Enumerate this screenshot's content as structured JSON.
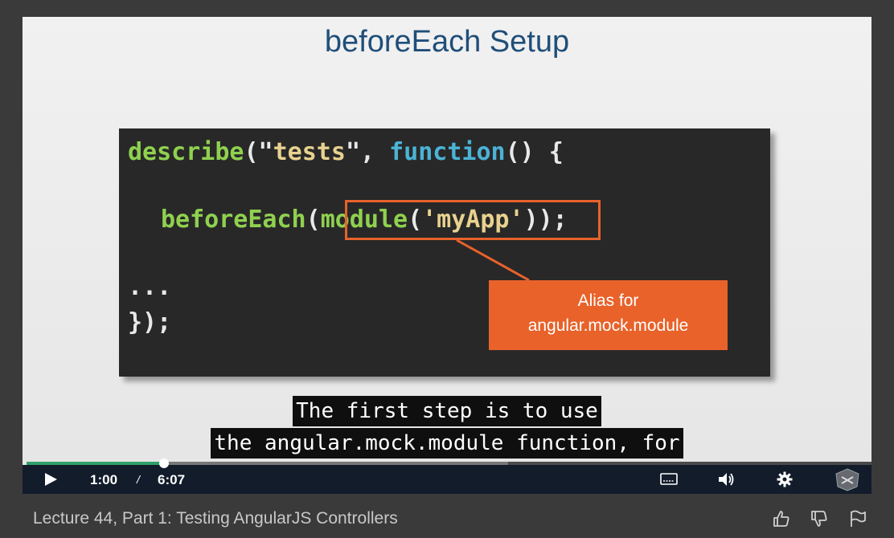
{
  "slide": {
    "title": "beforeEach Setup",
    "code": {
      "line1": {
        "a": "describe",
        "b": "(\"",
        "c": "tests",
        "d": "\", ",
        "e": "function",
        "f": "() {"
      },
      "line2": {
        "a": "beforeEach",
        "b": "(",
        "c": "module",
        "d": "(",
        "e": "'myApp'",
        "f": ")",
        "g": ");"
      },
      "line3": "...",
      "line4": "});"
    },
    "callout": {
      "line1": "Alias for",
      "line2": "angular.mock.module"
    }
  },
  "captions": {
    "line1": "The first step is to use",
    "line2": "the angular.mock.module function, for"
  },
  "player": {
    "current_time": "1:00",
    "separator": "/",
    "duration": "6:07",
    "progress_fraction": 0.163,
    "buffered_fraction": 0.57,
    "icons": [
      "play-icon",
      "captions-icon",
      "volume-icon",
      "settings-icon",
      "logo-icon"
    ]
  },
  "lecture": {
    "title": "Lecture 44, Part 1: Testing AngularJS Controllers"
  },
  "colors": {
    "accent": "#2fa06a",
    "callout": "#e8622a",
    "title": "#1f4e79"
  }
}
